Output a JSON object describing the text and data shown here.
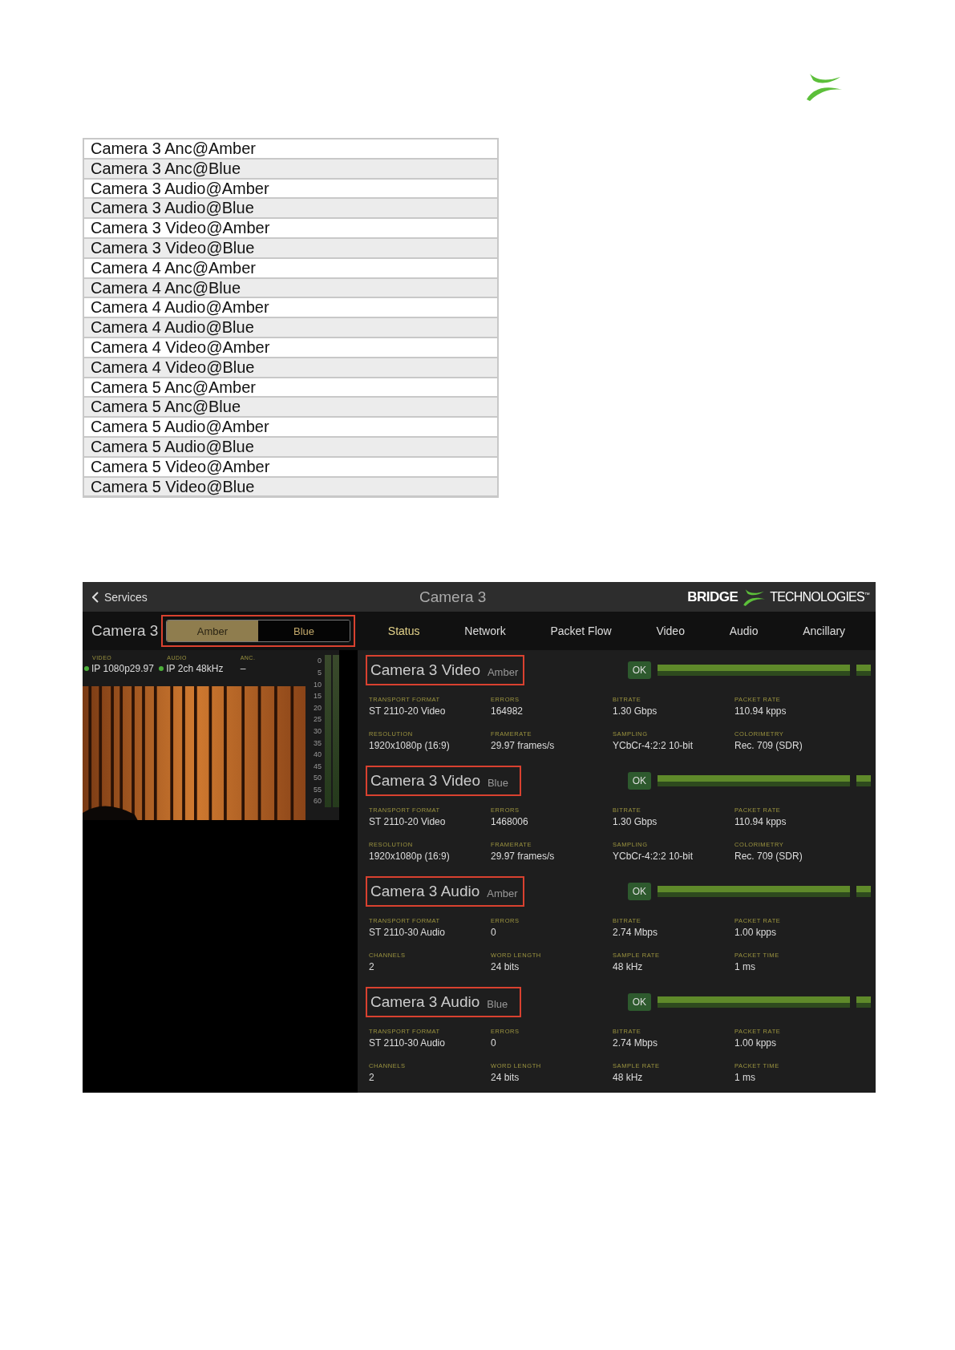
{
  "stream_list": [
    "Camera 3 Anc@Amber",
    "Camera 3 Anc@Blue",
    "Camera 3 Audio@Amber",
    "Camera 3 Audio@Blue",
    "Camera 3 Video@Amber",
    "Camera 3 Video@Blue",
    "Camera 4 Anc@Amber",
    "Camera 4 Anc@Blue",
    "Camera 4 Audio@Amber",
    "Camera 4 Audio@Blue",
    "Camera 4 Video@Amber",
    "Camera 4 Video@Blue",
    "Camera 5 Anc@Amber",
    "Camera 5 Anc@Blue",
    "Camera 5 Audio@Amber",
    "Camera 5 Audio@Blue",
    "Camera 5 Video@Amber",
    "Camera 5 Video@Blue"
  ],
  "app": {
    "back": "Services",
    "title": "Camera 3",
    "brand_bold": "BRIDGE",
    "brand_light": "TECHNOLOGIES",
    "trademark": "™",
    "camera_name": "Camera 3",
    "segments": [
      {
        "label": "Amber",
        "selected": true
      },
      {
        "label": "Blue",
        "selected": false
      }
    ],
    "tabs": [
      {
        "label": "Status",
        "selected": true
      },
      {
        "label": "Network",
        "selected": false
      },
      {
        "label": "Packet Flow",
        "selected": false
      },
      {
        "label": "Video",
        "selected": false
      },
      {
        "label": "Audio",
        "selected": false
      },
      {
        "label": "Ancillary",
        "selected": false
      }
    ],
    "sources": [
      {
        "label": "VIDEO",
        "value": "IP 1080p29.97",
        "active": true
      },
      {
        "label": "AUDIO",
        "value": "IP 2ch 48kHz",
        "active": true
      },
      {
        "label": "ANC.",
        "value": "–",
        "active": false
      }
    ],
    "meter_scale": [
      "0",
      "5",
      "10",
      "15",
      "20",
      "25",
      "30",
      "35",
      "40",
      "45",
      "50",
      "55",
      "60"
    ],
    "streams": [
      {
        "title": "Camera 3 Video",
        "path": "Amber",
        "status": "OK",
        "fields": [
          {
            "label": "TRANSPORT FORMAT",
            "value": "ST 2110-20 Video"
          },
          {
            "label": "ERRORS",
            "value": "164982"
          },
          {
            "label": "BITRATE",
            "value": "1.30 Gbps"
          },
          {
            "label": "PACKET RATE",
            "value": "110.94 kpps"
          },
          {
            "label": "RESOLUTION",
            "value": "1920x1080p (16:9)"
          },
          {
            "label": "FRAMERATE",
            "value": "29.97 frames/s"
          },
          {
            "label": "SAMPLING",
            "value": "YCbCr-4:2:2 10-bit"
          },
          {
            "label": "COLORIMETRY",
            "value": "Rec. 709 (SDR)"
          }
        ]
      },
      {
        "title": "Camera 3 Video",
        "path": "Blue",
        "status": "OK",
        "fields": [
          {
            "label": "TRANSPORT FORMAT",
            "value": "ST 2110-20 Video"
          },
          {
            "label": "ERRORS",
            "value": "1468006"
          },
          {
            "label": "BITRATE",
            "value": "1.30 Gbps"
          },
          {
            "label": "PACKET RATE",
            "value": "110.94 kpps"
          },
          {
            "label": "RESOLUTION",
            "value": "1920x1080p (16:9)"
          },
          {
            "label": "FRAMERATE",
            "value": "29.97 frames/s"
          },
          {
            "label": "SAMPLING",
            "value": "YCbCr-4:2:2 10-bit"
          },
          {
            "label": "COLORIMETRY",
            "value": "Rec. 709 (SDR)"
          }
        ]
      },
      {
        "title": "Camera 3 Audio",
        "path": "Amber",
        "status": "OK",
        "fields": [
          {
            "label": "TRANSPORT FORMAT",
            "value": "ST 2110-30 Audio"
          },
          {
            "label": "ERRORS",
            "value": "0"
          },
          {
            "label": "BITRATE",
            "value": "2.74 Mbps"
          },
          {
            "label": "PACKET RATE",
            "value": "1.00 kpps"
          },
          {
            "label": "CHANNELS",
            "value": "2"
          },
          {
            "label": "WORD LENGTH",
            "value": "24 bits"
          },
          {
            "label": "SAMPLE RATE",
            "value": "48 kHz"
          },
          {
            "label": "PACKET TIME",
            "value": "1 ms"
          }
        ]
      },
      {
        "title": "Camera 3 Audio",
        "path": "Blue",
        "status": "OK",
        "fields": [
          {
            "label": "TRANSPORT FORMAT",
            "value": "ST 2110-30 Audio"
          },
          {
            "label": "ERRORS",
            "value": "0"
          },
          {
            "label": "BITRATE",
            "value": "2.74 Mbps"
          },
          {
            "label": "PACKET RATE",
            "value": "1.00 kpps"
          },
          {
            "label": "CHANNELS",
            "value": "2"
          },
          {
            "label": "WORD LENGTH",
            "value": "24 bits"
          },
          {
            "label": "SAMPLE RATE",
            "value": "48 kHz"
          },
          {
            "label": "PACKET TIME",
            "value": "1 ms"
          }
        ]
      }
    ]
  }
}
